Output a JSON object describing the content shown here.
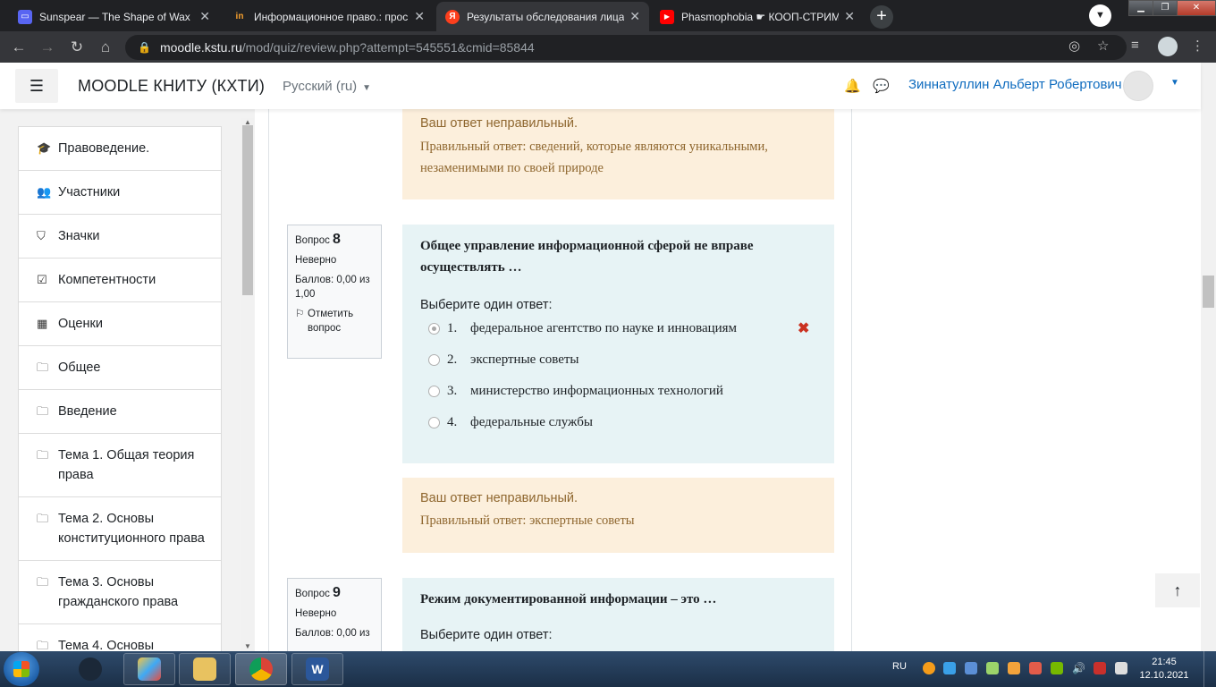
{
  "browser": {
    "tabs": [
      {
        "title": "Sunspear — The Shape of Wax",
        "active": false,
        "fav_color": "#5865f2"
      },
      {
        "title": "Информационное право.: прос",
        "active": false,
        "fav_color": "#202124"
      },
      {
        "title": "Результаты обследования лица,",
        "active": true,
        "fav_color": "#fc3f1d"
      },
      {
        "title": "Phasmophobia ☛ КООП-СТРИМ",
        "active": false,
        "fav_color": "#ff0000"
      }
    ],
    "url_host": "moodle.kstu.ru",
    "url_path": "/mod/quiz/review.php?attempt=545551&cmid=85844"
  },
  "navbar": {
    "site_name": "MOODLE КНИТУ (КХТИ)",
    "language": "Русский (ru)",
    "username": "Зиннатуллин Альберт Робертович"
  },
  "drawer": {
    "items": [
      {
        "icon": "graduation-cap-icon",
        "glyph": "🎓",
        "label": "Правоведение."
      },
      {
        "icon": "users-icon",
        "glyph": "👥",
        "label": "Участники"
      },
      {
        "icon": "shield-icon",
        "glyph": "⛉",
        "label": "Значки"
      },
      {
        "icon": "checkbox-icon",
        "glyph": "☑",
        "label": "Компетентности"
      },
      {
        "icon": "table-icon",
        "glyph": "▦",
        "label": "Оценки"
      },
      {
        "icon": "folder-icon",
        "glyph": "🗀",
        "label": "Общее"
      },
      {
        "icon": "folder-icon",
        "glyph": "🗀",
        "label": "Введение"
      },
      {
        "icon": "folder-icon",
        "glyph": "🗀",
        "label": "Тема 1. Общая теория права"
      },
      {
        "icon": "folder-icon",
        "glyph": "🗀",
        "label": "Тема 2. Основы конституционного права"
      },
      {
        "icon": "folder-icon",
        "glyph": "🗀",
        "label": "Тема 3. Основы гражданского права"
      },
      {
        "icon": "folder-icon",
        "glyph": "🗀",
        "label": "Тема 4. Основы"
      }
    ]
  },
  "main": {
    "prev_feedback": {
      "line1": "Ваш ответ неправильный.",
      "line2": "Правильный ответ: сведений, которые являются уникальными, незаменимыми по своей природе"
    },
    "q8": {
      "label": "Вопрос",
      "number": "8",
      "state": "Неверно",
      "grade": "Баллов: 0,00 из 1,00",
      "flag": "Отметить вопрос",
      "text": "Общее управление информационной сферой не вправе осуществлять …",
      "prompt": "Выберите один ответ:",
      "answers": [
        {
          "num": "1.",
          "text": "федеральное агентство по науке и инновациям",
          "selected": true
        },
        {
          "num": "2.",
          "text": "экспертные советы",
          "selected": false
        },
        {
          "num": "3.",
          "text": "министерство информационных технологий",
          "selected": false
        },
        {
          "num": "4.",
          "text": "федеральные службы",
          "selected": false
        }
      ],
      "feedback_line1": "Ваш ответ неправильный.",
      "feedback_line2": "Правильный ответ: экспертные советы"
    },
    "q9": {
      "label": "Вопрос",
      "number": "9",
      "state": "Неверно",
      "grade": "Баллов: 0,00 из",
      "text": "Режим документированной информации – это …",
      "prompt": "Выберите один ответ:"
    }
  },
  "taskbar": {
    "lang": "RU",
    "time": "21:45",
    "date": "12.10.2021"
  }
}
